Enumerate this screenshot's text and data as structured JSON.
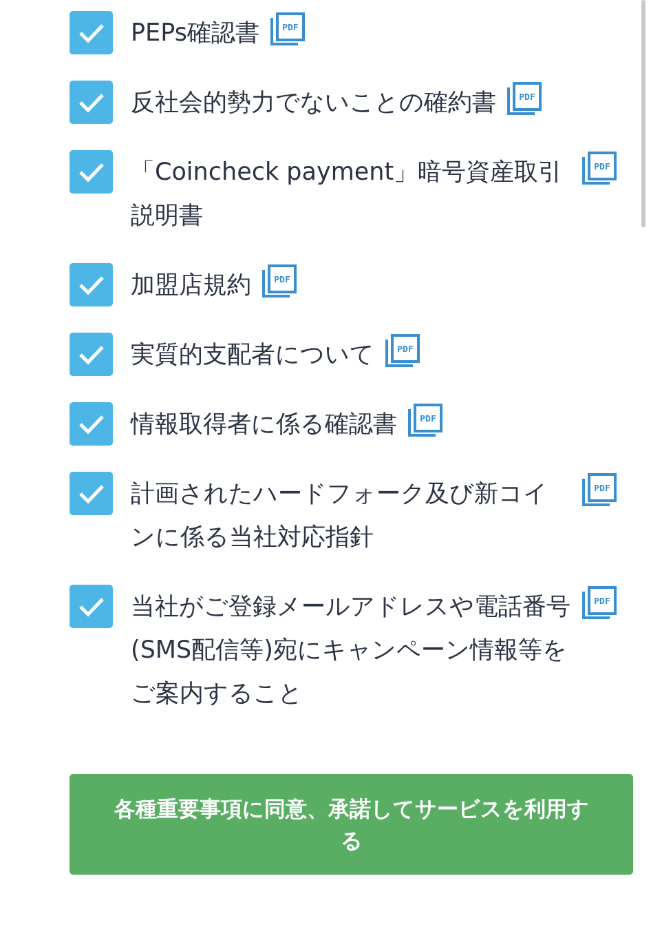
{
  "agreements": [
    {
      "label": "PEPs確認書",
      "checked": true,
      "pdf_label": "PDF"
    },
    {
      "label": "反社会的勢力でないことの確約書",
      "checked": true,
      "pdf_label": "PDF"
    },
    {
      "label": "「Coincheck payment」暗号資産取引説明書",
      "checked": true,
      "pdf_label": "PDF"
    },
    {
      "label": "加盟店規約",
      "checked": true,
      "pdf_label": "PDF"
    },
    {
      "label": "実質的支配者について",
      "checked": true,
      "pdf_label": "PDF"
    },
    {
      "label": "情報取得者に係る確認書",
      "checked": true,
      "pdf_label": "PDF"
    },
    {
      "label": "計画されたハードフォーク及び新コインに係る当社対応指針",
      "checked": true,
      "pdf_label": "PDF"
    },
    {
      "label": "当社がご登録メールアドレスや電話番号(SMS配信等)宛にキャンペーン情報等をご案内すること",
      "checked": true,
      "pdf_label": "PDF"
    }
  ],
  "submit_button": "各種重要事項に同意、承諾してサービスを利用する"
}
